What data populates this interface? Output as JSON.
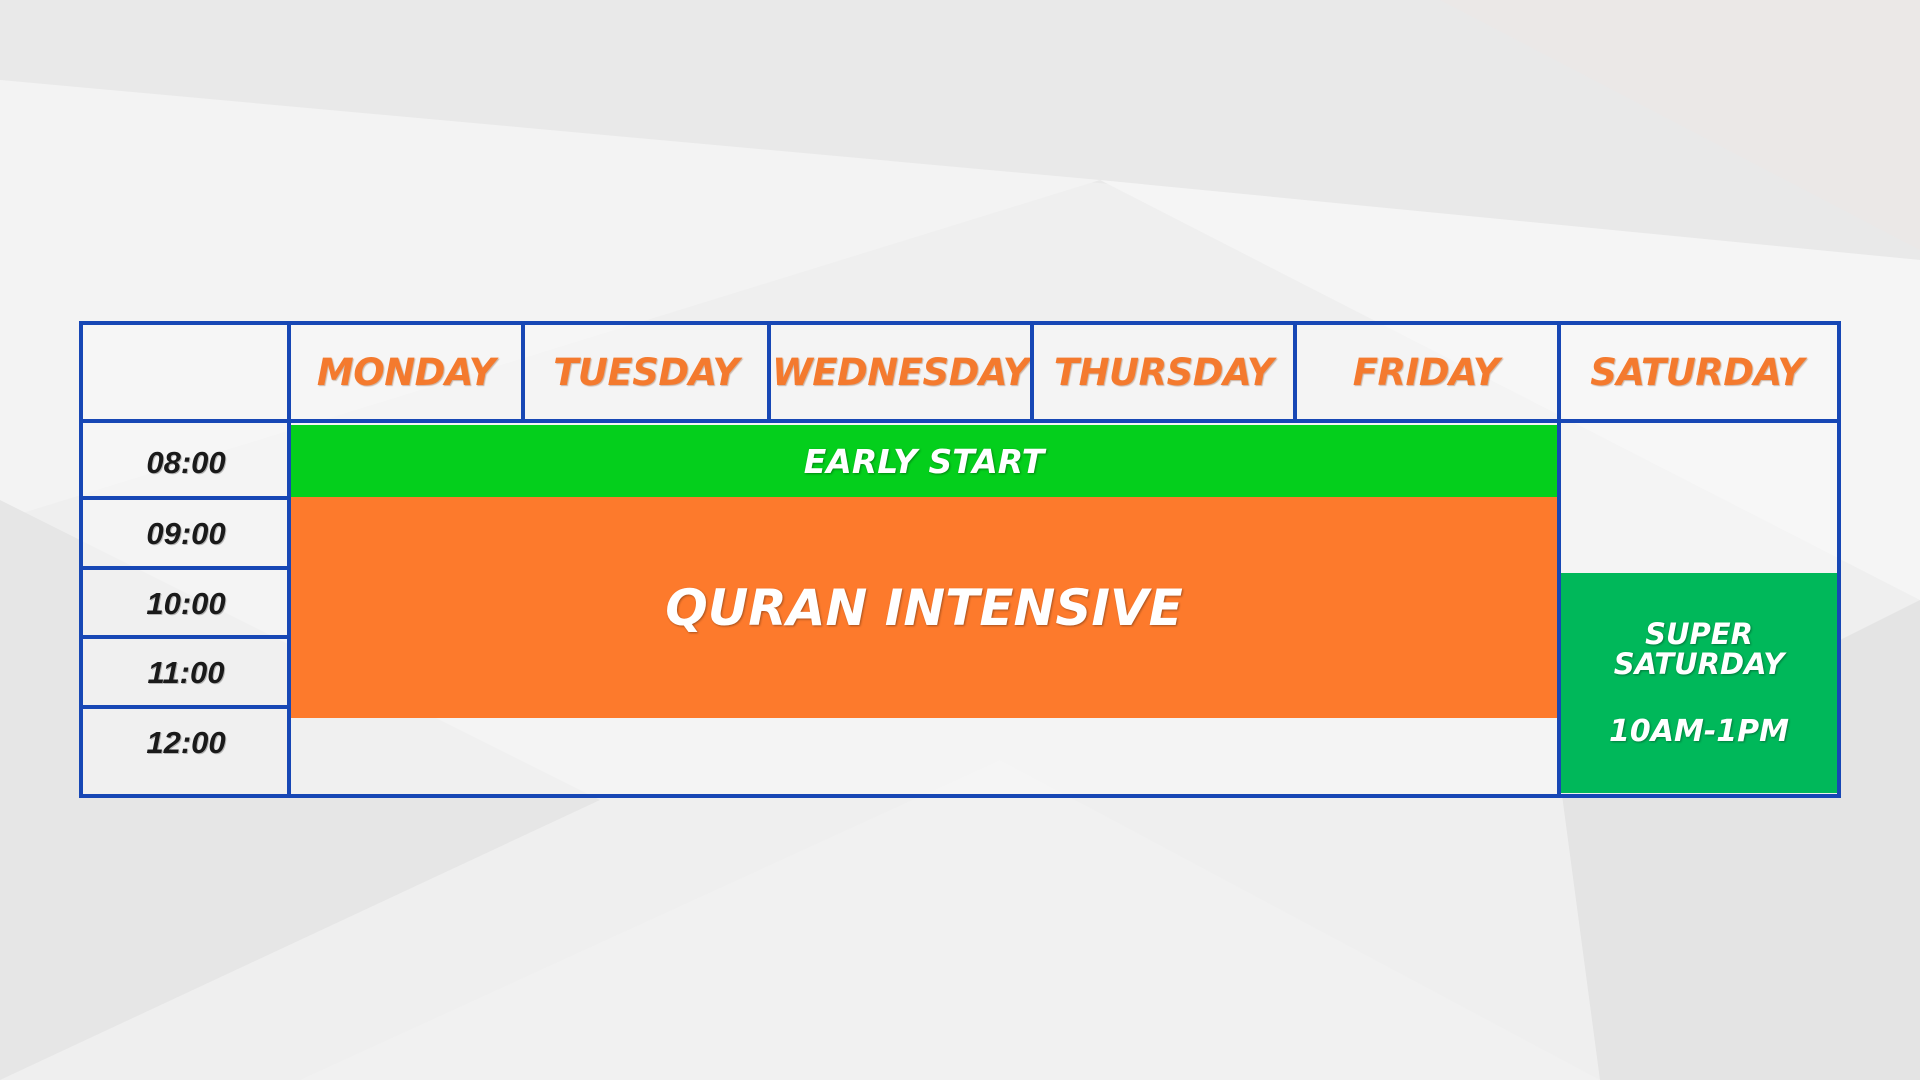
{
  "days": [
    "MONDAY",
    "TUESDAY",
    "WEDNESDAY",
    "THURSDAY",
    "FRIDAY",
    "SATURDAY"
  ],
  "times": [
    "08:00",
    "09:00",
    "10:00",
    "11:00",
    "12:00"
  ],
  "sessions": {
    "early_start": "EARLY START",
    "quran_intensive": "QURAN INTENSIVE",
    "super_saturday_title_1": "SUPER",
    "super_saturday_title_2": "SATURDAY",
    "super_saturday_time": "10AM-1PM"
  },
  "colors": {
    "border": "#1747b5",
    "day_text": "#f47a2e",
    "early_start": "#04cf1c",
    "quran_intensive": "#fd7a2c",
    "super_saturday": "#00b85a"
  }
}
